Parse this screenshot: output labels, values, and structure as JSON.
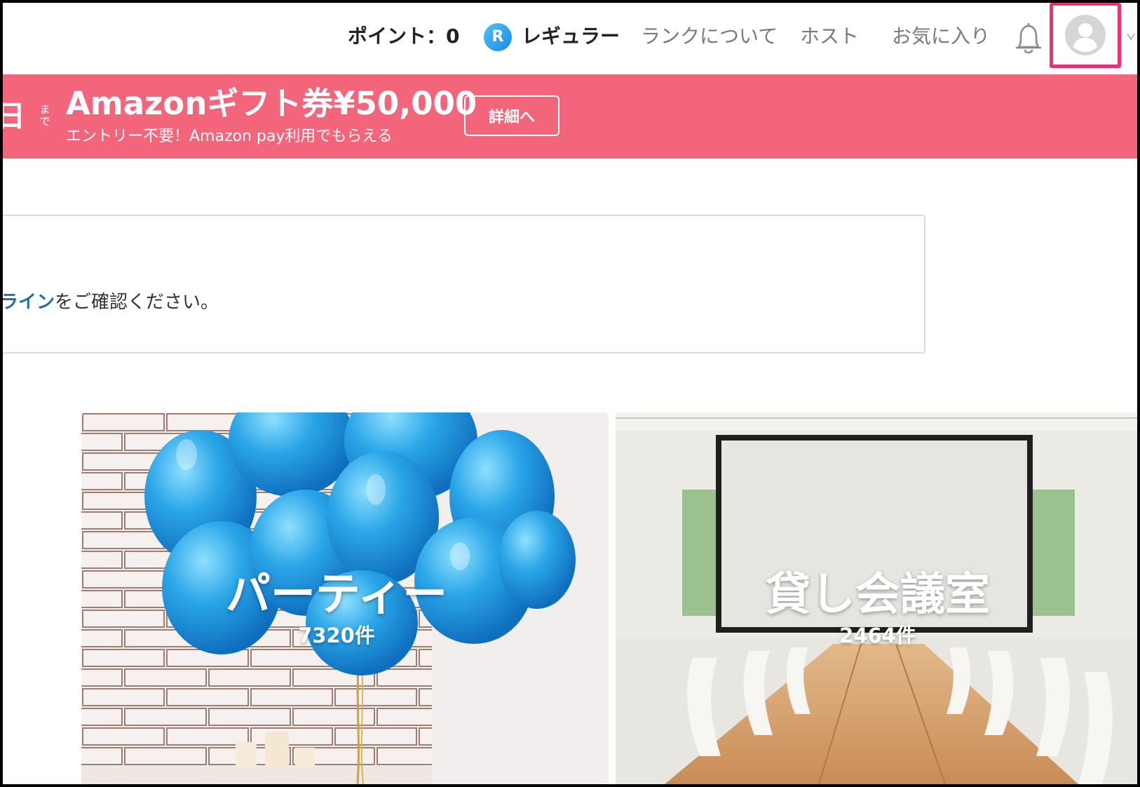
{
  "header": {
    "points_label": "ポイント：0",
    "rank_badge": "R",
    "rank_label": "レギュラー",
    "nav": {
      "about_rank": "ランクについて",
      "host": "ホスト",
      "favorites": "お気に入り"
    },
    "icons": {
      "notifications": "bell-icon",
      "user": "user-avatar-icon",
      "menu": "chevron-down-icon"
    },
    "highlight_color": "#e9317a"
  },
  "banner": {
    "countdown_day": "日",
    "countdown_made": "まで",
    "title": "Amazonギフト券¥50,000",
    "subtitle": "エントリー不要！Amazon pay利用でもらえる",
    "detail_button": "詳細へ",
    "background": "#f2657b"
  },
  "notice": {
    "link_text": "ドライン",
    "text": "をご確認ください。",
    "link_color": "#1a6fb0"
  },
  "categories": [
    {
      "title": "パーティー",
      "count": "7320件",
      "image": "blue-balloons-photo"
    },
    {
      "title": "貸し会議室",
      "count": "2464件",
      "image": "meeting-room-photo"
    }
  ]
}
